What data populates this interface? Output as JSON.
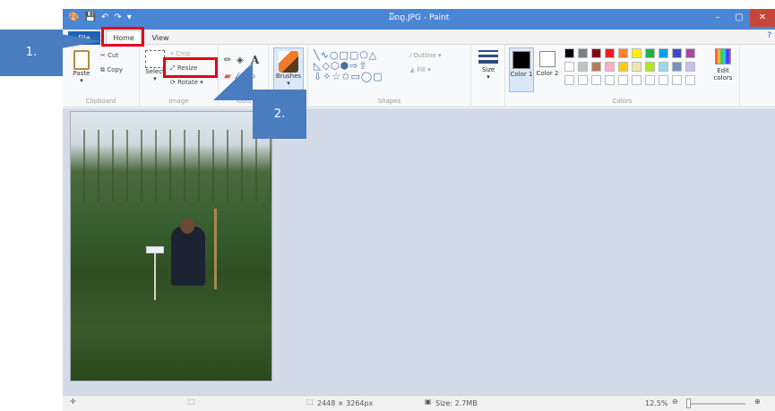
{
  "window": {
    "title": "ມັດດູ.JPG - Paint",
    "minimize": "–",
    "maximize": "▢",
    "close": "✕"
  },
  "tabs": {
    "file": "File",
    "home": "Home",
    "view": "View",
    "help": "?"
  },
  "clipboard": {
    "paste": "Paste",
    "cut": "Cut",
    "copy": "Copy",
    "label": "Clipboard"
  },
  "image": {
    "select": "Select",
    "crop": "Crop",
    "resize": "Resize",
    "rotate": "Rotate",
    "label": "Image"
  },
  "tools": {
    "label": "Tools",
    "text_tool": "A"
  },
  "brushes": {
    "label": "Brushes"
  },
  "shapes": {
    "outline": "Outline",
    "fill": "Fill",
    "label": "Shapes"
  },
  "size": {
    "label": "Size"
  },
  "colors": {
    "color1": "Color 1",
    "color2": "Color 2",
    "edit": "Edit colors",
    "label": "Colors",
    "row1": [
      "#000000",
      "#7f7f7f",
      "#880015",
      "#ed1c24",
      "#ff7f27",
      "#fff200",
      "#22b14c",
      "#00a2e8",
      "#3f48cc",
      "#a349a4"
    ],
    "row2": [
      "#ffffff",
      "#c3c3c3",
      "#b97a57",
      "#ffaec9",
      "#ffc90e",
      "#efe4b0",
      "#b5e61d",
      "#99d9ea",
      "#7092be",
      "#c8bfe7"
    ]
  },
  "status": {
    "dimensions": "2448 × 3264px",
    "size": "Size: 2.7MB",
    "zoom": "12.5%"
  },
  "callouts": {
    "step1": "1.",
    "step2": "2."
  }
}
